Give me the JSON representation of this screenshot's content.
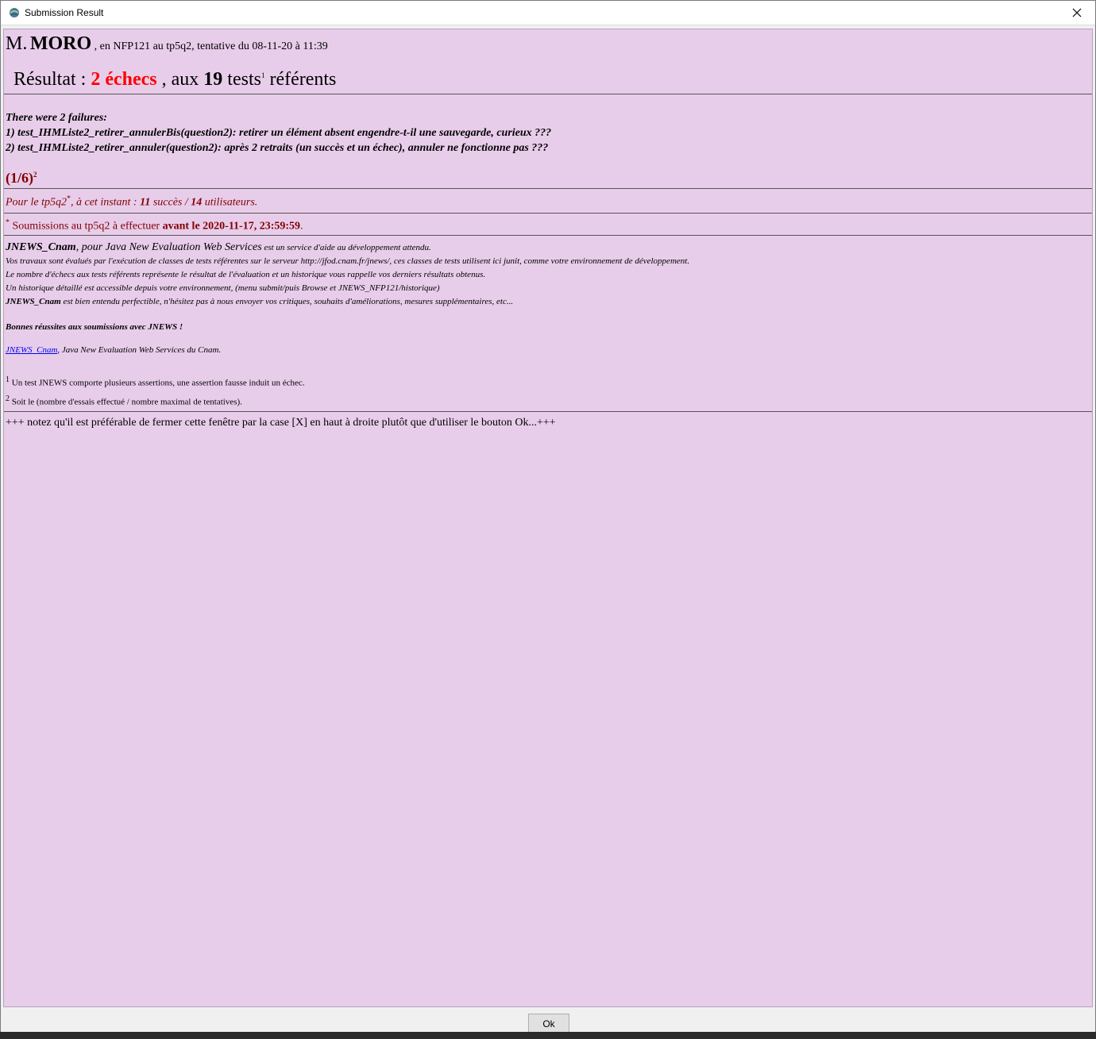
{
  "window": {
    "title": "Submission Result"
  },
  "header": {
    "mr": "M.",
    "name": "MORO",
    "context": ", en NFP121 au tp5q2, tentative du 08-11-20 à 11:39"
  },
  "result": {
    "label": "Résultat :",
    "failures_count": "2 échecs",
    "middle": ", aux",
    "tests_count": "19",
    "tests_word": "tests",
    "footnote_mark": "1",
    "end": "référents"
  },
  "failures": {
    "intro": "There were 2 failures:",
    "items": [
      "1) test_IHMListe2_retirer_annulerBis(question2): retirer un élément absent engendre-t-il une sauvegarde, curieux ???",
      "2) test_IHMListe2_retirer_annuler(question2): après 2 retraits (un succès et un échec), annuler ne fonctionne pas ???"
    ]
  },
  "attempts": {
    "value": "(1/6)",
    "footnote_mark": "2"
  },
  "stats": {
    "prefix": "Pour le tp5q2",
    "star": "*",
    "middle": ", à cet instant :",
    "success_count": "11",
    "success_word": "succès /",
    "users_count": "14",
    "users_word": "utilisateurs."
  },
  "deadline": {
    "star": "*",
    "text": " Soumissions au tp5q2 à effectuer ",
    "bold": "avant le 2020-11-17, 23:59:59",
    "end": "."
  },
  "info": {
    "brand": "JNEWS_Cnam",
    "brand_desc": ", pour Java New Evaluation Web Services",
    "brand_desc_small": " est un service d'aide au développement attendu.",
    "line2": "Vos travaux sont évalués par l'exécution de classes de tests référentes sur le serveur http://jfod.cnam.fr/jnews/, ces classes de tests utilisent ici junit, comme votre environnement de développement.",
    "line3": "Le nombre d'échecs aux tests référents représente le résultat de l'évaluation et un historique vous rappelle vos derniers résultats obtenus.",
    "line4": "Un historique détaillé est accessible depuis votre environnement, (menu submit/puis Browse et JNEWS_NFP121/historique)",
    "brand2": "JNEWS_Cnam",
    "line5": " est bien entendu perfectible, n'hésitez pas à nous envoyer vos critiques, souhaits d'améliorations, mesures supplémentaires, etc..."
  },
  "bonnes": "Bonnes réussites aux soumissions avec JNEWS !",
  "credit": {
    "link": "JNEWS_Cnam",
    "text": ", Java New Evaluation Web Services du Cnam."
  },
  "footnotes": {
    "n1": "1",
    "t1": " Un test JNEWS comporte plusieurs assertions, une assertion fausse induit un échec.",
    "n2": "2",
    "t2": " Soit le (nombre d'essais effectué / nombre maximal de tentatives)."
  },
  "note": "+++ notez qu'il est préférable de fermer cette fenêtre par la case [X] en haut à droite plutôt que d'utiliser le bouton Ok...+++",
  "ok_label": "Ok"
}
